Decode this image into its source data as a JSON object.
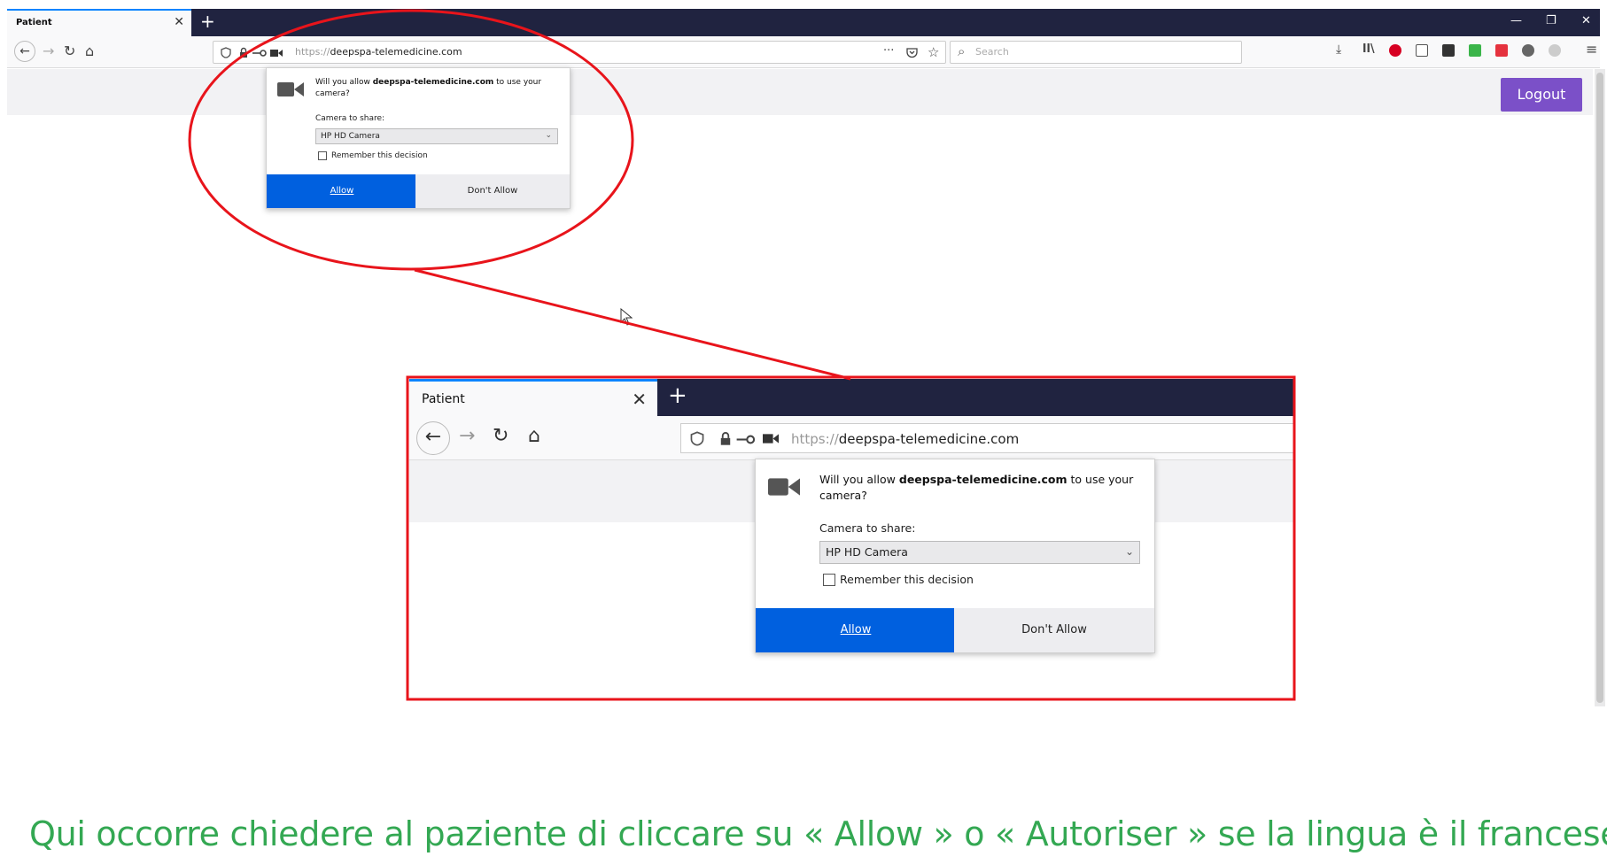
{
  "colors": {
    "accent": "#0060df",
    "logout": "#7b50c8",
    "annotation": "#e8141b",
    "caption": "#34a853",
    "tabbar": "#202340"
  },
  "browser": {
    "tab_title": "Patient",
    "url_scheme": "https://",
    "url_host": "deepspa-telemedicine.com",
    "search_placeholder": "Search",
    "logout_label": "Logout"
  },
  "popup": {
    "question_prefix": "Will you allow ",
    "question_host": "deepspa-telemedicine.com",
    "question_suffix": " to use your camera?",
    "camera_label": "Camera to share:",
    "camera_selected": "HP HD Camera",
    "remember_label": "Remember this decision",
    "allow_label": "Allow",
    "deny_label": "Don't Allow"
  },
  "icons": {
    "back": "←",
    "forward": "→",
    "reload": "↻",
    "home": "⌂",
    "close": "✕",
    "new_tab": "+",
    "more": "···",
    "star": "☆",
    "search": "⌕",
    "menu": "≡",
    "chevron": "⌄"
  },
  "caption": "Qui occorre chiedere al paziente di cliccare su « Allow » o « Autoriser » se la lingua è il francese"
}
